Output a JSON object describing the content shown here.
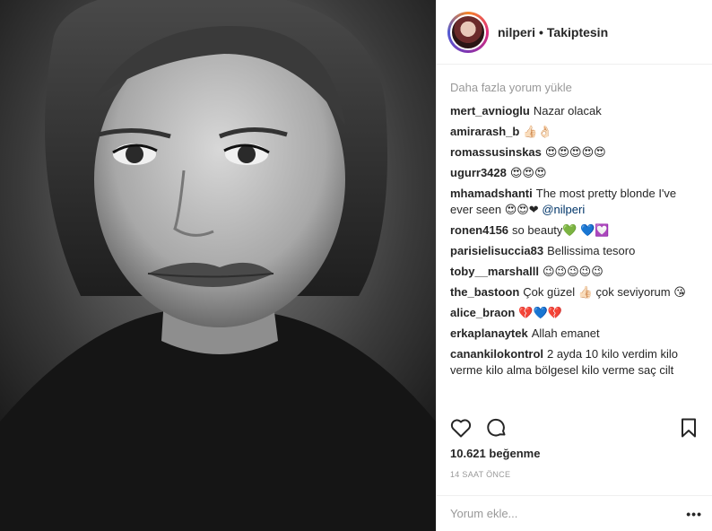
{
  "post": {
    "username": "nilperi",
    "separator": "•",
    "follow_status": "Takiptesin"
  },
  "comments": {
    "load_more": "Daha fazla yorum yükle",
    "items": [
      {
        "user": "mert_avnioglu",
        "text": "Nazar olacak"
      },
      {
        "user": "amirarash_b",
        "text": "👍🏻👌🏻"
      },
      {
        "user": "romassusinskas",
        "text": "😍😍😍😍😍"
      },
      {
        "user": "ugurr3428",
        "text": "😍😍😍"
      },
      {
        "user": "mhamadshanti",
        "text": "The most pretty blonde I've ever seen 😍😍❤",
        "mention": "@nilperi"
      },
      {
        "user": "ronen4156",
        "text": "so beauty💚 💙💟"
      },
      {
        "user": "parisielisuccia83",
        "text": "Bellissima tesoro"
      },
      {
        "user": "toby__marshalll",
        "text": "😉😉😉😉😉"
      },
      {
        "user": "the_bastoon",
        "text": "Çok güzel 👍🏻 çok seviyorum 😘"
      },
      {
        "user": "alice_braon",
        "text": "💔💙💔"
      },
      {
        "user": "erkaplanaytek",
        "text": "Allah emanet"
      },
      {
        "user": "canankilokontrol",
        "text": "2 ayda 10 kilo verdim kilo verme kilo alma bölgesel kilo verme saç cilt"
      }
    ]
  },
  "actions": {
    "like_icon": "heart-outline-icon",
    "comment_icon": "comment-bubble-icon",
    "save_icon": "bookmark-icon"
  },
  "likes_text": "10.621 beğenme",
  "time_text": "14 SAAT ÖNCE",
  "add_comment": {
    "placeholder": "Yorum ekle...",
    "more_label": "•••"
  }
}
